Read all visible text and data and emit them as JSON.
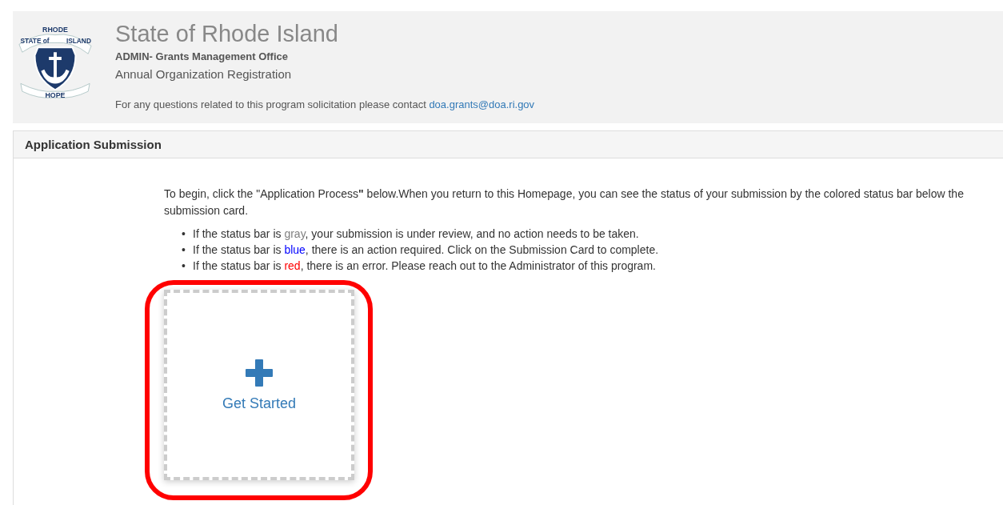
{
  "seal": {
    "top": "RHODE",
    "left": "STATE of",
    "right": "ISLAND",
    "bottom": "HOPE"
  },
  "header": {
    "title": "State of Rhode Island",
    "office": "ADMIN- Grants Management Office",
    "program": "Annual Organization Registration",
    "contact_text": "For any questions related to this program solicitation please contact ",
    "contact_email": "doa.grants@doa.ri.gov"
  },
  "panel": {
    "heading": "Application Submission",
    "intro": "To begin, click the \"Application Process**\"** below.When you return to this Homepage, you can see the status of your submission by the colored status bar below the submission card.",
    "bullets": [
      {
        "marker": "•",
        "before": "If the status bar is ",
        "word": "gray",
        "color": "#808080",
        "after": ", your submission is under review, and no action needs to be taken."
      },
      {
        "marker": "•",
        "before": "If the status bar is ",
        "word": "blue",
        "color": "#0000ff",
        "after": ", there is an action required. Click on the Submission Card to complete."
      },
      {
        "marker": "•",
        "before": "If the status bar is ",
        "word": "red",
        "color": "#ff0000",
        "after": ", there is an error. Please reach out to the Administrator of this program."
      }
    ],
    "card": {
      "label": "Get Started",
      "highlighted": true
    }
  }
}
